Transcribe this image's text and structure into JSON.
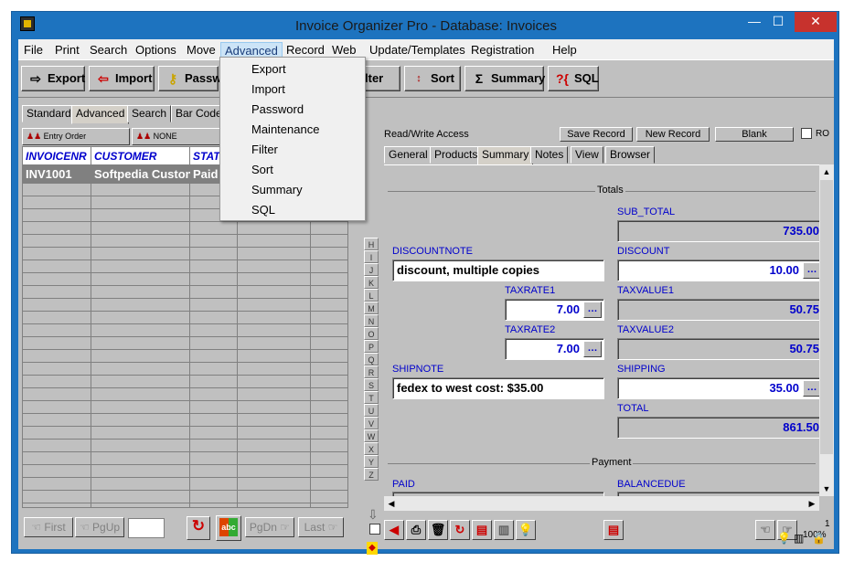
{
  "window": {
    "title": "Invoice Organizer Pro - Database: Invoices",
    "minimize": "—",
    "maximize": "☐",
    "close": "✕"
  },
  "menubar": [
    "File",
    "Print",
    "Search",
    "Options",
    "Move",
    "Advanced",
    "Record",
    "Web",
    "Update/Templates",
    "Registration",
    "Help"
  ],
  "toolbar": {
    "export": "Export",
    "import": "Import",
    "password": "Passw",
    "filter": "lter",
    "sort": "Sort",
    "summary": "Summary",
    "sql": "SQL"
  },
  "advanced_menu": [
    "Export",
    "Import",
    "Password",
    "Maintenance",
    "Filter",
    "Sort",
    "Summary",
    "SQL"
  ],
  "left_tabs": [
    "Standard",
    "Advanced",
    "Search",
    "Bar Code"
  ],
  "order": {
    "entry": "Entry Order",
    "none": "NONE"
  },
  "grid": {
    "columns": [
      "INVOICENR",
      "CUSTOMER",
      "STAT"
    ],
    "rows": [
      [
        "INV1001",
        "Softpedia Custon",
        "Paid"
      ]
    ]
  },
  "letters": [
    "H",
    "I",
    "J",
    "K",
    "L",
    "M",
    "N",
    "O",
    "P",
    "Q",
    "R",
    "S",
    "T",
    "U",
    "V",
    "W",
    "X",
    "Y",
    "Z"
  ],
  "record_bar": {
    "access": "Read/Write Access",
    "save": "Save Record",
    "new": "New Record",
    "blank": "Blank",
    "ro": "RO"
  },
  "detail_tabs": [
    "General",
    "Products",
    "Summary",
    "Notes",
    "View",
    "Browser"
  ],
  "summary": {
    "totals_header": "Totals",
    "sub_total_label": "SUB_TOTAL",
    "sub_total": "735.00",
    "discountnote_label": "DISCOUNTNOTE",
    "discountnote": "discount, multiple copies",
    "discount_label": "DISCOUNT",
    "discount": "10.00",
    "taxrate1_label": "TAXRATE1",
    "taxrate1": "7.00",
    "taxvalue1_label": "TAXVALUE1",
    "taxvalue1": "50.75",
    "taxrate2_label": "TAXRATE2",
    "taxrate2": "7.00",
    "taxvalue2_label": "TAXVALUE2",
    "taxvalue2": "50.75",
    "shipnote_label": "SHIPNOTE",
    "shipnote": "fedex to west cost: $35.00",
    "shipping_label": "SHIPPING",
    "shipping": "35.00",
    "total_label": "TOTAL",
    "total": "861.50",
    "payment_header": "Payment",
    "paid_label": "PAID",
    "balancedue_label": "BALANCEDUE",
    "dots": "…"
  },
  "nav": {
    "first": "First",
    "pgup": "PgUp",
    "pgdn": "PgDn",
    "last": "Last"
  },
  "status": {
    "page": "1",
    "zoom": "100%"
  }
}
